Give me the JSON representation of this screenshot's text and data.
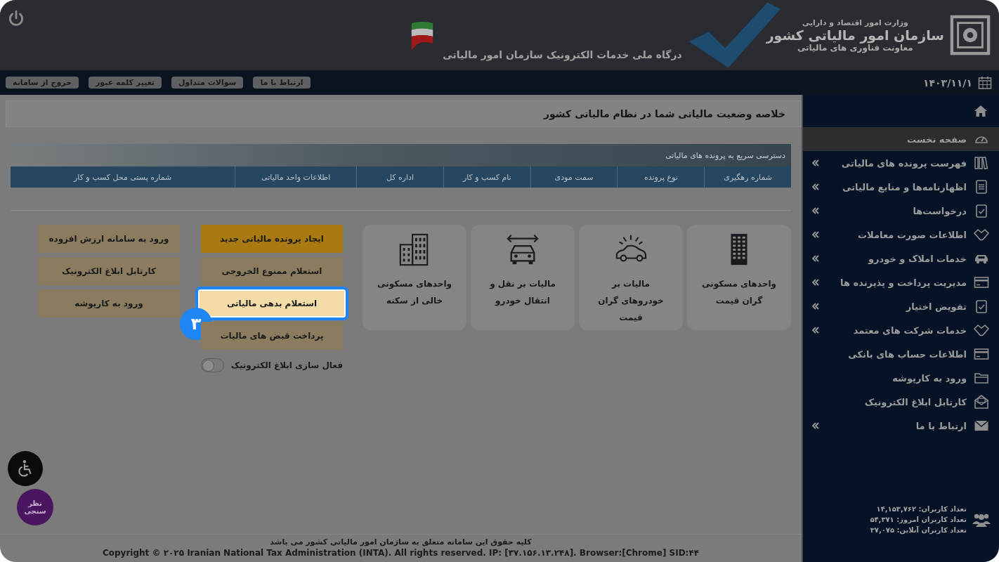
{
  "header": {
    "ministry": "وزارت امور اقتصاد و دارایی",
    "organization": "سازمان امور مالیاتی کشور",
    "department": "معاونت فناوری های مالیاتی",
    "portal_title": "درگاه ملی خدمات الکترونیک سازمان امور مالیاتی"
  },
  "toolbar": {
    "date": "۱۴۰۳/۱۱/۱",
    "buttons": [
      "ارتباط با ما",
      "سوالات متداول",
      "تغییر کلمه عبور",
      "خروج از سامانه"
    ]
  },
  "sidebar": {
    "items": [
      {
        "label": "صفحه نخست",
        "selected": true,
        "has_submenu": false
      },
      {
        "label": "فهرست پرونده های مالیاتی",
        "selected": false,
        "has_submenu": true
      },
      {
        "label": "اظهارنامه‌ها و منابع مالیاتی",
        "selected": false,
        "has_submenu": true
      },
      {
        "label": "درخواست‌ها",
        "selected": false,
        "has_submenu": true
      },
      {
        "label": "اطلاعات صورت معاملات",
        "selected": false,
        "has_submenu": true
      },
      {
        "label": "خدمات املاک و خودرو",
        "selected": false,
        "has_submenu": true
      },
      {
        "label": "مدیریت پرداخت و پذیرنده ها",
        "selected": false,
        "has_submenu": true
      },
      {
        "label": "تفویض اختیار",
        "selected": false,
        "has_submenu": true
      },
      {
        "label": "خدمات شرکت های معتمد",
        "selected": false,
        "has_submenu": true
      },
      {
        "label": "اطلاعات حساب های بانکی",
        "selected": false,
        "has_submenu": false
      },
      {
        "label": "ورود به کارپوشه",
        "selected": false,
        "has_submenu": false
      },
      {
        "label": "کارتابل ابلاغ الکترونیک",
        "selected": false,
        "has_submenu": false
      },
      {
        "label": "ارتباط با ما",
        "selected": false,
        "has_submenu": true
      }
    ],
    "stats": [
      "تعداد کاربران: ۱۴,۱۵۳,۷۶۲",
      "تعداد کاربران امروز: ۵۴,۳۷۱",
      "تعداد کاربران آنلاین: ۳۷,۰۷۵"
    ]
  },
  "summary_title": "خلاصه وضعیت مالیاتی شما در نظام مالیاتی کشور",
  "quick_access": {
    "title": "دسترسی سریع به پرونده های مالیاتی",
    "columns": [
      "شماره رهگیری",
      "نوع پرونده",
      "سمت مودی",
      "نام کسب و کار",
      "اداره کل",
      "اطلاعات واحد مالیاتی",
      "شماره پستی محل کسب و کار"
    ]
  },
  "service_cards": [
    {
      "label": "واحدهای مسکونی گران قیمت"
    },
    {
      "label": "مالیات بر خودروهای گران قیمت"
    },
    {
      "label": "مالیات بر نقل و انتقال خودرو"
    },
    {
      "label": "واحدهای مسکونی خالی از سکنه"
    }
  ],
  "action_buttons": [
    [
      {
        "label": "ایجاد پرونده مالیاتی جدید",
        "kind": "primary",
        "highlighted": false
      },
      {
        "label": "استعلام ممنوع الخروجی",
        "kind": "secondary",
        "highlighted": false
      },
      {
        "label": "استعلام بدهی مالیاتی",
        "kind": "secondary",
        "highlighted": true
      },
      {
        "label": "پرداخت قبض های مالیات",
        "kind": "secondary",
        "highlighted": false
      }
    ],
    [
      {
        "label": "ورود به سامانه ارزش افزوده",
        "kind": "secondary",
        "highlighted": false
      },
      {
        "label": "کارتابل ابلاغ الکترونیک",
        "kind": "secondary",
        "highlighted": false
      },
      {
        "label": "ورود به کارپوشه",
        "kind": "secondary",
        "highlighted": false
      }
    ]
  ],
  "step_badge": "۳",
  "toggle": {
    "label": "فعال سازی ابلاغ الکترونیک",
    "on": false
  },
  "survey_button": "نظر سنجی",
  "footer": {
    "rights": "کلیه حقوق این سامانه متعلق به سازمان امور مالیاتی کشور می باشد",
    "copyright": "Copyright © ۲۰۲۵ Iranian National Tax Administration (INTA). All rights reserved. IP: [۳۷.۱۵۶.۱۳.۲۴۸]. Browser:[Chrome] SID:۴۴"
  }
}
